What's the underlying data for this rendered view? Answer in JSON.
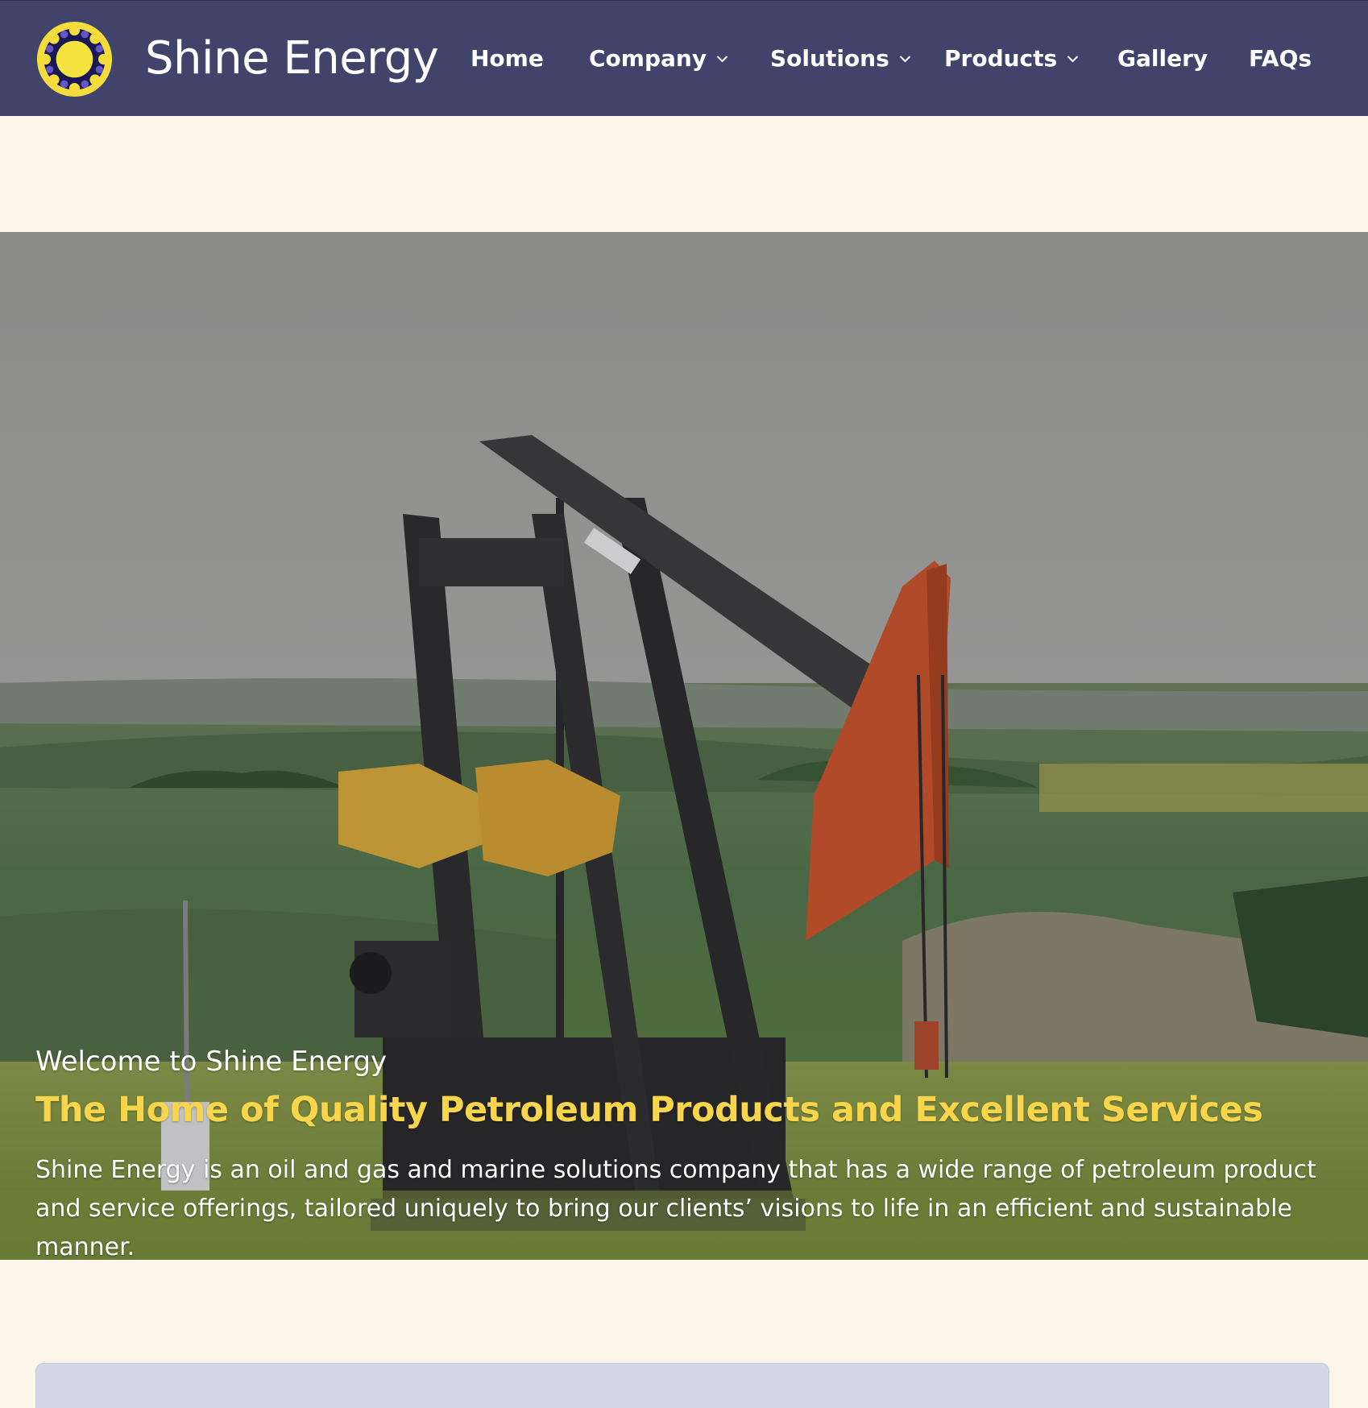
{
  "brand": {
    "name": "Shine Energy",
    "logo_icon": "sun-logo-icon"
  },
  "nav": {
    "items": [
      {
        "label": "Home",
        "has_dropdown": false
      },
      {
        "label": "Company",
        "has_dropdown": true
      },
      {
        "label": "Solutions",
        "has_dropdown": true
      },
      {
        "label": "Products",
        "has_dropdown": true
      },
      {
        "label": "Gallery",
        "has_dropdown": false
      },
      {
        "label": "FAQs",
        "has_dropdown": false
      }
    ]
  },
  "hero": {
    "kicker": "Welcome to Shine Energy",
    "title": "The Home of Quality Petroleum Products and Excellent Services",
    "body": "Shine Energy is an oil and gas and marine solutions company that has a wide range of petroleum product and service offerings, tailored uniquely to bring our clients’ visions to life in an efficient and sustainable manner.",
    "image": "oil-pumpjack-photo"
  },
  "colors": {
    "header_bg": "#42436a",
    "page_bg": "#fbf7ea",
    "accent_yellow": "#f8d54a",
    "card_bg": "#d2d8e6"
  }
}
